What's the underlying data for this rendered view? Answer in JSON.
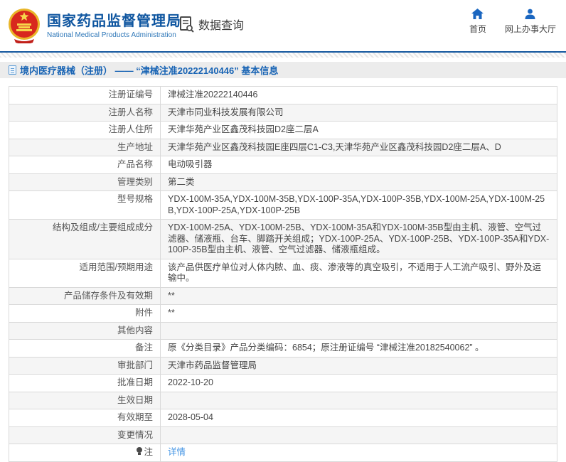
{
  "header": {
    "title": "国家药品监督管理局",
    "subtitle": "National Medical Products Administration",
    "data_query_label": "数据查询",
    "nav": [
      {
        "label": "首页",
        "icon": "home-icon"
      },
      {
        "label": "网上办事大厅",
        "icon": "person-icon"
      }
    ]
  },
  "breadcrumb": {
    "text": "境内医疗器械（注册） ——  “津械注准20222140446” 基本信息"
  },
  "table": {
    "rows": [
      {
        "label": "注册证编号",
        "value": "津械注准20222140446"
      },
      {
        "label": "注册人名称",
        "value": "天津市同业科技发展有限公司"
      },
      {
        "label": "注册人住所",
        "value": "天津华苑产业区鑫茂科技园D2座二层A"
      },
      {
        "label": "生产地址",
        "value": "天津华苑产业区鑫茂科技园E座四层C1-C3,天津华苑产业区鑫茂科技园D2座二层A、D"
      },
      {
        "label": "产品名称",
        "value": "电动吸引器"
      },
      {
        "label": "管理类别",
        "value": "第二类"
      },
      {
        "label": "型号规格",
        "value": "YDX-100M-35A,YDX-100M-35B,YDX-100P-35A,YDX-100P-35B,YDX-100M-25A,YDX-100M-25B,YDX-100P-25A,YDX-100P-25B"
      },
      {
        "label": "结构及组成/主要组成成分",
        "value": "YDX-100M-25A、YDX-100M-25B、YDX-100M-35A和YDX-100M-35B型由主机、液管、空气过滤器、储液瓶、台车、脚踏开关组成；YDX-100P-25A、YDX-100P-25B、YDX-100P-35A和YDX-100P-35B型由主机、液管、空气过滤器、储液瓶组成。"
      },
      {
        "label": "适用范围/预期用途",
        "value": "该产品供医疗单位对人体内脓、血、痰、渗液等的真空吸引，不适用于人工流产吸引、野外及运输中。"
      },
      {
        "label": "产品储存条件及有效期",
        "value": "**"
      },
      {
        "label": "附件",
        "value": "**"
      },
      {
        "label": "其他内容",
        "value": ""
      },
      {
        "label": "备注",
        "value": "原《分类目录》产品分类编码：6854；原注册证编号 “津械注准20182540062” 。"
      },
      {
        "label": "审批部门",
        "value": "天津市药品监督管理局"
      },
      {
        "label": "批准日期",
        "value": "2022-10-20"
      },
      {
        "label": "生效日期",
        "value": ""
      },
      {
        "label": "有效期至",
        "value": "2028-05-04"
      },
      {
        "label": "变更情况",
        "value": ""
      },
      {
        "label": "注",
        "value": "详情",
        "label_icon": "bulb-icon",
        "value_is_link": true
      }
    ]
  },
  "colors": {
    "brand_blue": "#0f56a0",
    "nav_icon_blue": "#1a66c0",
    "link_blue": "#4394e4",
    "breadcrumb_blue": "#1763b4",
    "row_alt_gray": "#f5f5f5",
    "border_gray": "#d9d9d9"
  }
}
